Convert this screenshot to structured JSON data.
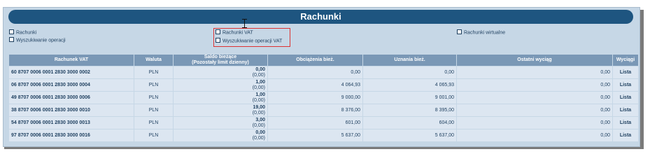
{
  "header": {
    "title": "Rachunki"
  },
  "links": [
    {
      "label": "Rachunki"
    },
    {
      "label": "Wyszukiwanie operacji"
    },
    {
      "label": "Rachunki VAT"
    },
    {
      "label": "Wyszukiwanie operacji VAT"
    },
    {
      "label": "Rachunki wirtualne"
    }
  ],
  "table": {
    "headers": {
      "account": "Rachunek VAT",
      "currency": "Waluta",
      "balance_line1": "Saldo bieżące",
      "balance_line2": "(Pozostały limit dzienny)",
      "debits": "Obciążenia bież.",
      "credits": "Uznania bież.",
      "last_statement": "Ostatni wyciąg",
      "statements": "Wyciągi"
    },
    "rows": [
      {
        "account": "60 8707 0006 0001 2830 3000 0002",
        "currency": "PLN",
        "balance": "0,00",
        "limit": "(0,00)",
        "debits": "0,00",
        "credits": "0,00",
        "last_statement": "0,00",
        "action": "Lista"
      },
      {
        "account": "06 8707 0006 0001 2830 3000 0004",
        "currency": "PLN",
        "balance": "1,00",
        "limit": "(0,00)",
        "debits": "4 064,93",
        "credits": "4 065,93",
        "last_statement": "0,00",
        "action": "Lista"
      },
      {
        "account": "49 8707 0006 0001 2830 3000 0006",
        "currency": "PLN",
        "balance": "1,00",
        "limit": "(0,00)",
        "debits": "9 000,00",
        "credits": "9 001,00",
        "last_statement": "0,00",
        "action": "Lista"
      },
      {
        "account": "38 8707 0006 0001 2830 3000 0010",
        "currency": "PLN",
        "balance": "19,00",
        "limit": "(0,00)",
        "debits": "8 376,00",
        "credits": "8 395,00",
        "last_statement": "0,00",
        "action": "Lista"
      },
      {
        "account": "54 8707 0006 0001 2830 3000 0013",
        "currency": "PLN",
        "balance": "3,00",
        "limit": "(0,00)",
        "debits": "601,00",
        "credits": "604,00",
        "last_statement": "0,00",
        "action": "Lista"
      },
      {
        "account": "97 8707 0006 0001 2830 3000 0016",
        "currency": "PLN",
        "balance": "0,00",
        "limit": "(0,00)",
        "debits": "5 637,00",
        "credits": "5 637,00",
        "last_statement": "0,00",
        "action": "Lista"
      }
    ]
  }
}
